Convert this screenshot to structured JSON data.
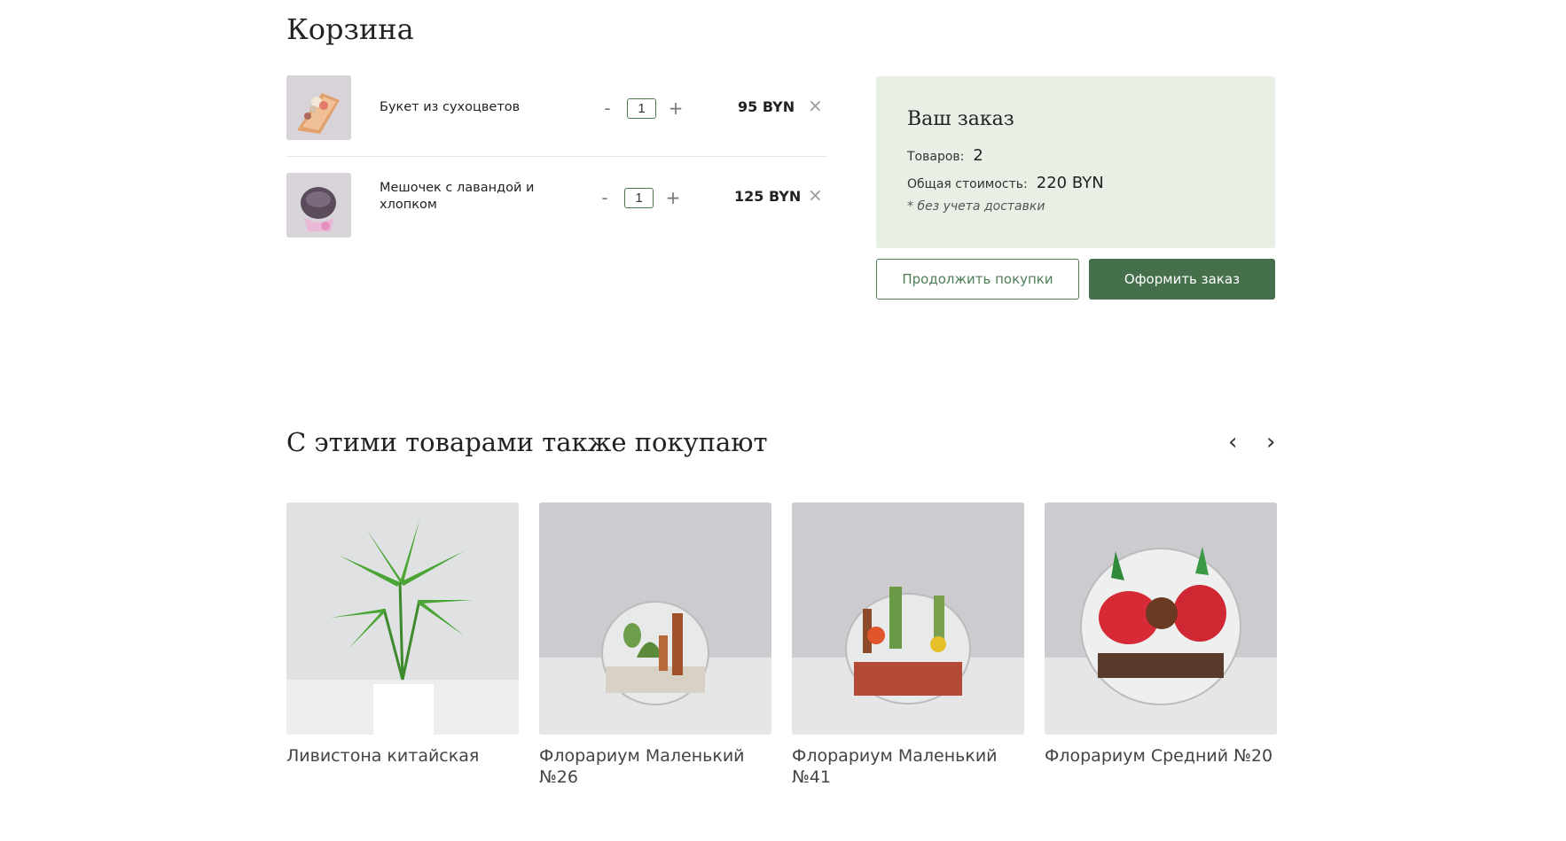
{
  "page": {
    "title": "Корзина"
  },
  "cart": {
    "items": [
      {
        "name": "Букет из сухоцветов",
        "quantity": "1",
        "price": "95 BYN",
        "minus": "-",
        "plus": "+",
        "remove": "×"
      },
      {
        "name": "Мешочек с лавандой и хлопком",
        "quantity": "1",
        "price": "125 BYN",
        "minus": "-",
        "plus": "+",
        "remove": "×"
      }
    ]
  },
  "summary": {
    "title": "Ваш заказ",
    "items_label": "Товаров:",
    "items_count": "2",
    "total_label": "Общая стоимость:",
    "total_value": "220 BYN",
    "note": "* без учета доставки"
  },
  "actions": {
    "continue_label": "Продолжить покупки",
    "checkout_label": "Оформить заказ"
  },
  "related": {
    "title": "С этими товарами также покупают",
    "prev": "‹",
    "next": "›",
    "products": [
      {
        "name": "Ливистона китайская"
      },
      {
        "name": "Флорариум Маленький №26"
      },
      {
        "name": "Флорариум Маленький №41"
      },
      {
        "name": "Флорариум Средний №20"
      }
    ]
  },
  "colors": {
    "accent": "#46704c",
    "summary_bg": "#e8f0e6"
  }
}
